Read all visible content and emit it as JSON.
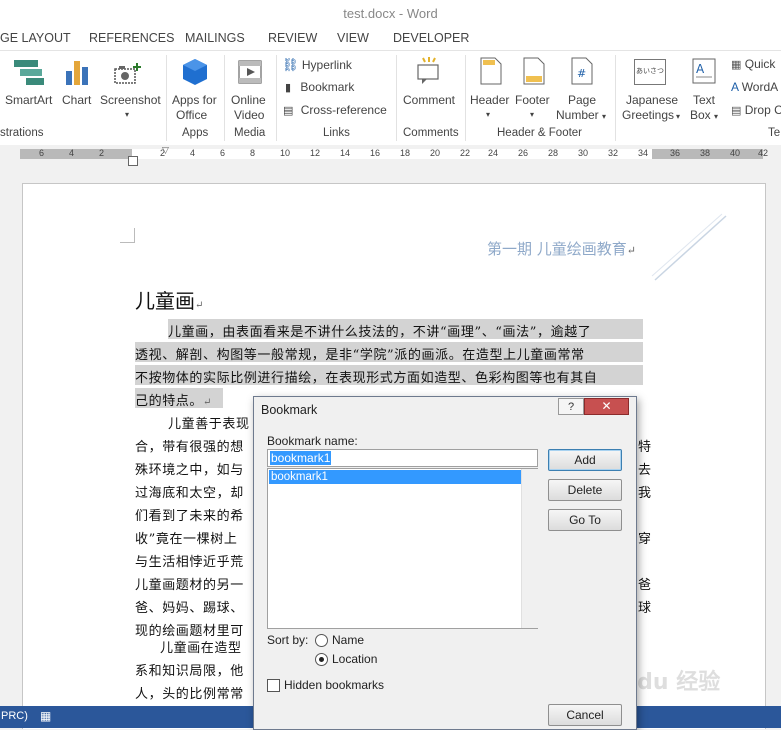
{
  "window": {
    "title": "test.docx - Word"
  },
  "tabs": [
    "GE LAYOUT",
    "REFERENCES",
    "MAILINGS",
    "REVIEW",
    "VIEW",
    "DEVELOPER"
  ],
  "ribbon": {
    "smartart": "SmartArt",
    "chart": "Chart",
    "screenshot": "Screenshot",
    "apps_for_office": [
      "Apps for",
      "Office"
    ],
    "online_video": [
      "Online",
      "Video"
    ],
    "hyperlink": "Hyperlink",
    "bookmark": "Bookmark",
    "cross_reference": "Cross-reference",
    "comment": "Comment",
    "header": "Header",
    "footer": "Footer",
    "page_number": [
      "Page",
      "Number"
    ],
    "japanese_greetings": [
      "Japanese",
      "Greetings"
    ],
    "text_box": [
      "Text",
      "Box"
    ],
    "quick_parts": "Quick",
    "wordart": "WordA",
    "drop_cap": "Drop C",
    "groups": {
      "illustrations": "strations",
      "apps": "Apps",
      "media": "Media",
      "links": "Links",
      "comments": "Comments",
      "header_footer": "Header & Footer",
      "text": "Te"
    },
    "japanese_icon_text": "あいさつ"
  },
  "ruler": {
    "ticks": [
      "6",
      "4",
      "2",
      "2",
      "4",
      "6",
      "8",
      "10",
      "12",
      "14",
      "16",
      "18",
      "20",
      "22",
      "24",
      "26",
      "28",
      "30",
      "32",
      "34",
      "36",
      "38",
      "40",
      "42"
    ]
  },
  "document": {
    "header_text": "第一期 儿童绘画教育",
    "heading": "儿童画",
    "para1": [
      "儿童画，由表面看来是不讲什么技法的，不讲“画理”、“画法”，逾越了",
      "透视、解剖、构图等一般常规，是非“学院”派的画派。在造型上儿童画常常",
      "不按物体的实际比例进行描绘，在表现形式方面如造型、色彩构图等也有其自",
      "己的特点。"
    ],
    "para2_left": [
      "儿童善于表现",
      "合，带有很强的想",
      "殊环境之中，如与",
      "过海底和太空，却",
      "们看到了未来的希",
      "收”竟在一棵树上",
      "与生活相悖近乎荒",
      "儿童画题材的另一",
      "爸、妈妈、踢球、",
      "现的绘画题材里可"
    ],
    "para2_right": [
      "特",
      "去",
      "我",
      "穿",
      "爸",
      "球"
    ],
    "para3_left": [
      "儿童画在造型",
      "系和知识局限，他",
      "人，头的比例常常"
    ]
  },
  "dialog": {
    "title": "Bookmark",
    "help": "?",
    "name_label": "Bookmark name:",
    "name_value": "bookmark1",
    "list_items": [
      "bookmark1"
    ],
    "add": "Add",
    "delete": "Delete",
    "goto": "Go To",
    "sort_by": "Sort by:",
    "sort_name": "Name",
    "sort_location": "Location",
    "hidden": "Hidden bookmarks",
    "cancel": "Cancel",
    "sort_selected": "Location"
  },
  "status": {
    "lang": "PRC)"
  },
  "watermark": "Baidu 经验",
  "colors": {
    "accent": "#2b579a",
    "close": "#c75050",
    "selection": "#3399ff"
  }
}
